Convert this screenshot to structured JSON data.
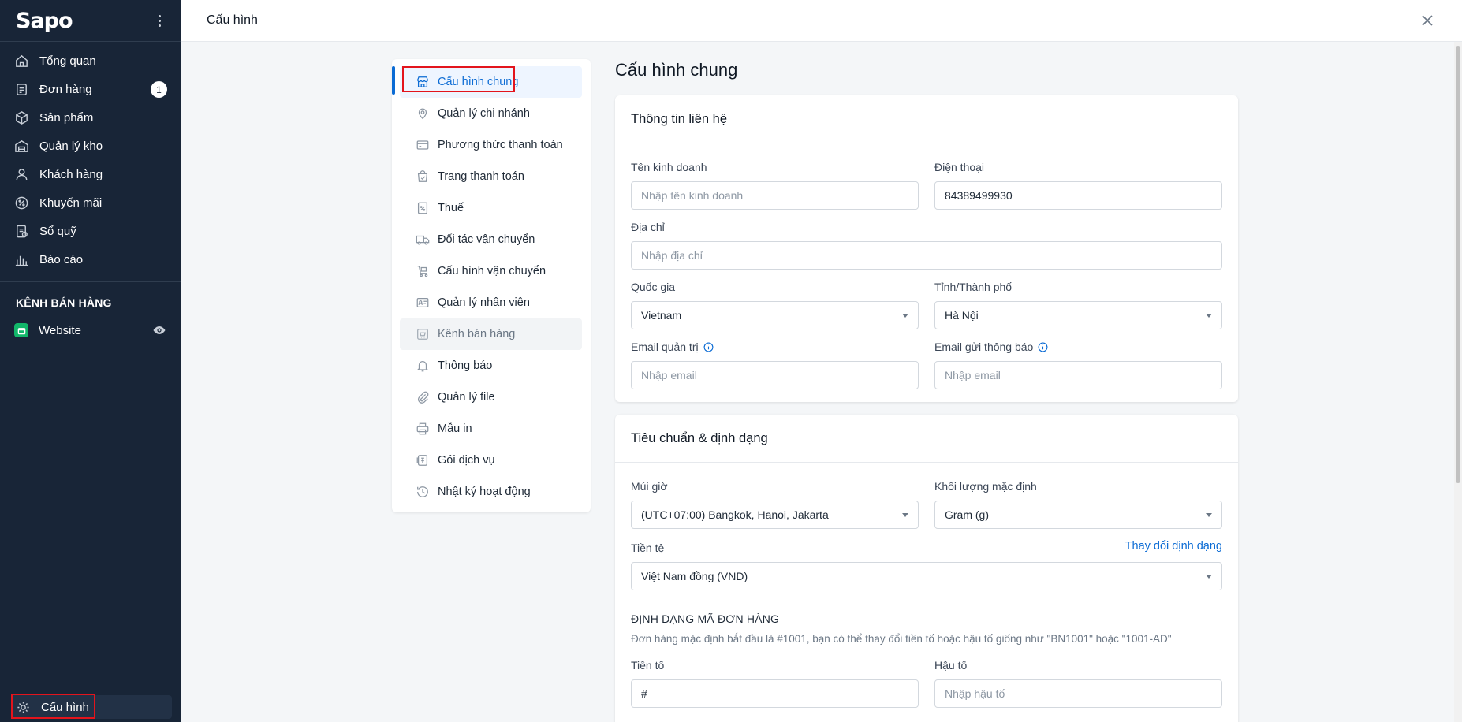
{
  "sidebar": {
    "logo": "Sapo",
    "items": [
      {
        "label": "Tổng quan",
        "icon": "home-icon"
      },
      {
        "label": "Đơn hàng",
        "icon": "order-icon",
        "badge": "1"
      },
      {
        "label": "Sản phẩm",
        "icon": "box-icon"
      },
      {
        "label": "Quản lý kho",
        "icon": "warehouse-icon"
      },
      {
        "label": "Khách hàng",
        "icon": "user-icon"
      },
      {
        "label": "Khuyến mãi",
        "icon": "discount-icon"
      },
      {
        "label": "Sổ quỹ",
        "icon": "cashbook-icon"
      },
      {
        "label": "Báo cáo",
        "icon": "chart-icon"
      }
    ],
    "channel_title": "KÊNH BÁN HÀNG",
    "website_label": "Website",
    "config_label": "Cấu hình"
  },
  "header": {
    "title": "Cấu hình"
  },
  "menu": {
    "items": [
      {
        "label": "Cấu hình chung",
        "icon": "store-icon"
      },
      {
        "label": "Quản lý chi nhánh",
        "icon": "branch-icon"
      },
      {
        "label": "Phương thức thanh toán",
        "icon": "card-icon"
      },
      {
        "label": "Trang thanh toán",
        "icon": "checkout-bag-icon"
      },
      {
        "label": "Thuế",
        "icon": "tax-icon"
      },
      {
        "label": "Đối tác vận chuyển",
        "icon": "truck-icon"
      },
      {
        "label": "Cấu hình vận chuyển",
        "icon": "shipping-config-icon"
      },
      {
        "label": "Quản lý nhân viên",
        "icon": "id-card-icon"
      },
      {
        "label": "Kênh bán hàng",
        "icon": "sales-channel-icon"
      },
      {
        "label": "Thông báo",
        "icon": "bell-icon"
      },
      {
        "label": "Quản lý file",
        "icon": "paperclip-icon"
      },
      {
        "label": "Mẫu in",
        "icon": "printer-icon"
      },
      {
        "label": "Gói dịch vụ",
        "icon": "service-package-icon"
      },
      {
        "label": "Nhật ký hoạt động",
        "icon": "history-icon"
      }
    ]
  },
  "main": {
    "page_title": "Cấu hình chung",
    "contact": {
      "title": "Thông tin liên hệ",
      "business_name_label": "Tên kinh doanh",
      "business_name_placeholder": "Nhập tên kinh doanh",
      "phone_label": "Điện thoại",
      "phone_value": "84389499930",
      "address_label": "Địa chỉ",
      "address_placeholder": "Nhập địa chỉ",
      "country_label": "Quốc gia",
      "country_value": "Vietnam",
      "city_label": "Tỉnh/Thành phố",
      "city_value": "Hà Nội",
      "admin_email_label": "Email quản trị",
      "admin_email_placeholder": "Nhập email",
      "notify_email_label": "Email gửi thông báo",
      "notify_email_placeholder": "Nhập email"
    },
    "standards": {
      "title": "Tiêu chuẩn & định dạng",
      "timezone_label": "Múi giờ",
      "timezone_value": "(UTC+07:00) Bangkok, Hanoi, Jakarta",
      "weight_label": "Khối lượng mặc định",
      "weight_value": "Gram (g)",
      "currency_label": "Tiền tệ",
      "currency_link": "Thay đổi định dạng",
      "currency_value": "Việt Nam đồng (VND)",
      "order_format_title": "ĐỊNH DẠNG MÃ ĐƠN HÀNG",
      "order_format_hint": "Đơn hàng mặc định bắt đầu là #1001, bạn có thể thay đổi tiền tố hoặc hậu tố giống như \"BN1001\" hoặc \"1001-AD\"",
      "prefix_label": "Tiền tố",
      "prefix_value": "#",
      "suffix_label": "Hậu tố",
      "suffix_placeholder": "Nhập hậu tố"
    }
  },
  "colors": {
    "sidebar_bg": "#182537",
    "accent": "#0b6bd4",
    "highlight": "#e3141c"
  }
}
